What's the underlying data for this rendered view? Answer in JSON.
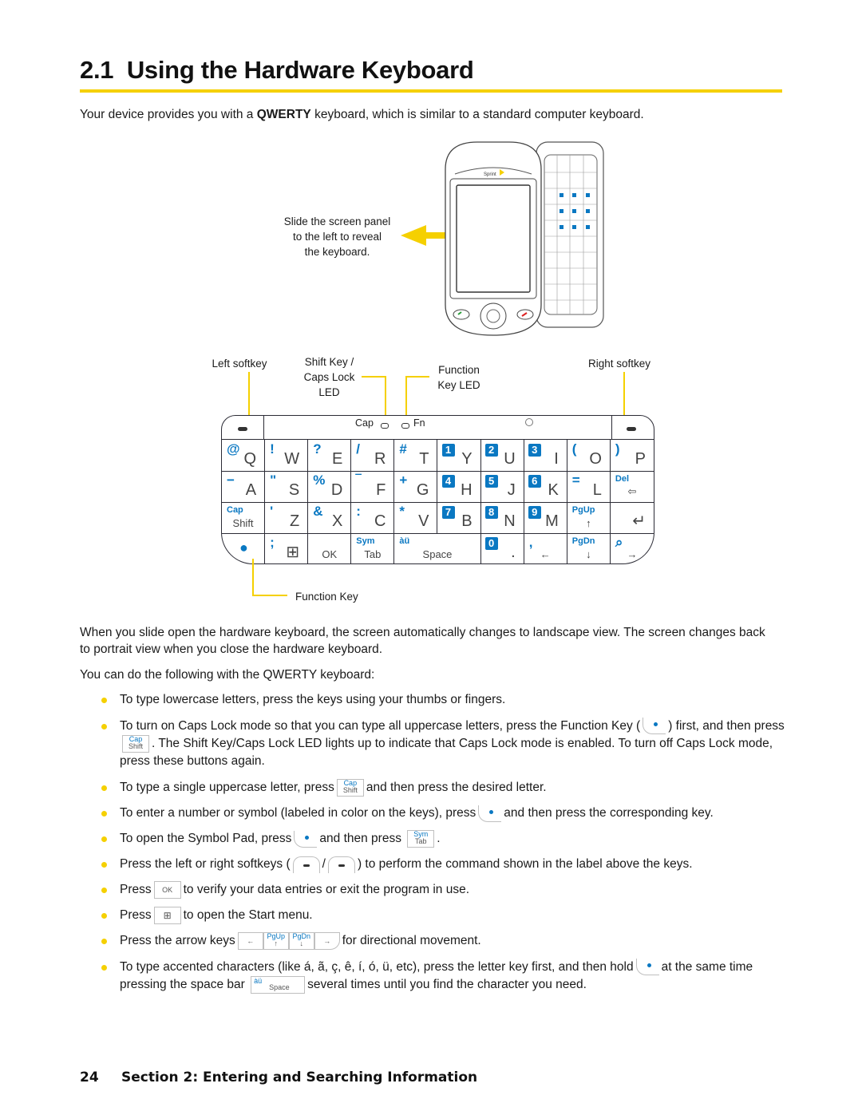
{
  "heading": {
    "number": "2.1",
    "title": "Using the Hardware Keyboard"
  },
  "intro": {
    "before": "Your device provides you with a ",
    "bold": "QWERTY",
    "after": " keyboard, which is similar to a standard computer keyboard."
  },
  "device_callout": [
    "Slide the screen panel",
    "to the left to reveal",
    "the keyboard."
  ],
  "device_brand": "Sprint",
  "keyboard_callouts": {
    "left_softkey": "Left softkey",
    "shift_led": [
      "Shift Key /",
      "Caps Lock",
      "LED"
    ],
    "function_led": [
      "Function",
      "Key LED"
    ],
    "right_softkey": "Right softkey",
    "function_key": "Function Key"
  },
  "keyboard": {
    "led_cap": "Cap",
    "led_fn": "Fn",
    "rows": [
      [
        {
          "fn": "@",
          "ltr": "Q"
        },
        {
          "fn": "!",
          "ltr": "W"
        },
        {
          "fn": "?",
          "ltr": "E"
        },
        {
          "fn": "/",
          "ltr": "R"
        },
        {
          "fn": "#",
          "ltr": "T"
        },
        {
          "num": "1",
          "ltr": "Y"
        },
        {
          "num": "2",
          "ltr": "U"
        },
        {
          "num": "3",
          "ltr": "I"
        },
        {
          "fn": "(",
          "ltr": "O"
        },
        {
          "fn": ")",
          "ltr": "P"
        }
      ],
      [
        {
          "fn": "−",
          "ltr": "A"
        },
        {
          "fn": "\"",
          "ltr": "S"
        },
        {
          "fn": "%",
          "ltr": "D"
        },
        {
          "fn": "‾",
          "ltr": "F"
        },
        {
          "fn": "+",
          "ltr": "G"
        },
        {
          "num": "4",
          "ltr": "H"
        },
        {
          "num": "5",
          "ltr": "J"
        },
        {
          "num": "6",
          "ltr": "K"
        },
        {
          "fn": "=",
          "ltr": "L"
        },
        {
          "fn": "Del",
          "ltr": "⇦",
          "small": true
        }
      ],
      [
        {
          "fn": "Cap",
          "ltr": "Shift",
          "small": true
        },
        {
          "fn": "'",
          "ltr": "Z"
        },
        {
          "fn": "&",
          "ltr": "X"
        },
        {
          "fn": ":",
          "ltr": "C"
        },
        {
          "fn": "*",
          "ltr": "V"
        },
        {
          "num": "7",
          "ltr": "B"
        },
        {
          "num": "8",
          "ltr": "N"
        },
        {
          "num": "9",
          "ltr": "M"
        },
        {
          "fn": "PgUp",
          "ltr": "↑",
          "small": true
        },
        {
          "fn": "",
          "ltr": "↵"
        }
      ],
      [
        {
          "fn": "●",
          "ltr": "",
          "name": "function-key"
        },
        {
          "fn": ";",
          "ltr": "⊞",
          "name": "start-key"
        },
        {
          "fn": "",
          "ltr": "OK",
          "small": true
        },
        {
          "fn": "Sym",
          "ltr": "Tab",
          "small": true
        },
        {
          "fn": "àü",
          "ltr": "Space",
          "small": true,
          "wide": true
        },
        {
          "num": "0",
          "ltr": "."
        },
        {
          "fn": ",",
          "ltr": "←",
          "small": true
        },
        {
          "fn": "PgDn",
          "ltr": "↓",
          "small": true
        },
        {
          "fn": "⌕",
          "ltr": "→",
          "small": true
        }
      ]
    ]
  },
  "body": {
    "p1": "When you slide open the hardware keyboard, the screen automatically changes to landscape view. The screen changes back to portrait view when you close the hardware keyboard.",
    "p2": "You can do the following with the QWERTY keyboard:"
  },
  "bullets": {
    "b1": "To type lowercase letters, press the keys using your thumbs or fingers.",
    "b2a": "To turn on Caps Lock mode so that you can type all uppercase letters, press the Function Key (",
    "b2b": ") first, and then press",
    "b2c": ". The Shift Key/Caps Lock LED lights up to indicate that Caps Lock mode is enabled. To turn off Caps Lock mode, press these buttons again.",
    "b3a": "To type a single uppercase letter, press",
    "b3b": "and then press the desired letter.",
    "b4a": "To enter a number or symbol (labeled in color on the keys), press",
    "b4b": "and then press the corresponding key.",
    "b5a": "To open the Symbol Pad, press",
    "b5b": "and then press",
    "b5c": ".",
    "b6a": "Press the left or right softkeys (",
    "b6b": "/",
    "b6c": ") to perform the command shown in the label above the keys.",
    "b7a": "Press",
    "b7b": "to verify your data entries or exit the program in use.",
    "b8a": "Press",
    "b8b": "to open the Start menu.",
    "b9a": "Press the arrow keys",
    "b9b": "for directional movement.",
    "b10a": "To type accented characters (like á, ã, ç, ê, í, ó, ü, etc), press the letter key first, and then hold",
    "b10b": "at the same time pressing the space bar",
    "b10c": "several times until you find the character you need."
  },
  "inline_keys": {
    "cap": "Cap",
    "shift": "Shift",
    "sym": "Sym",
    "tab": "Tab",
    "ok": "OK",
    "pgup": "PgUp",
    "pgdn": "PgDn",
    "au": "àü",
    "space": "Space"
  },
  "footer": {
    "page": "24",
    "section": "Section 2: Entering and Searching Information"
  },
  "colors": {
    "accent_yellow": "#f5d000",
    "key_blue": "#0a78c2"
  }
}
